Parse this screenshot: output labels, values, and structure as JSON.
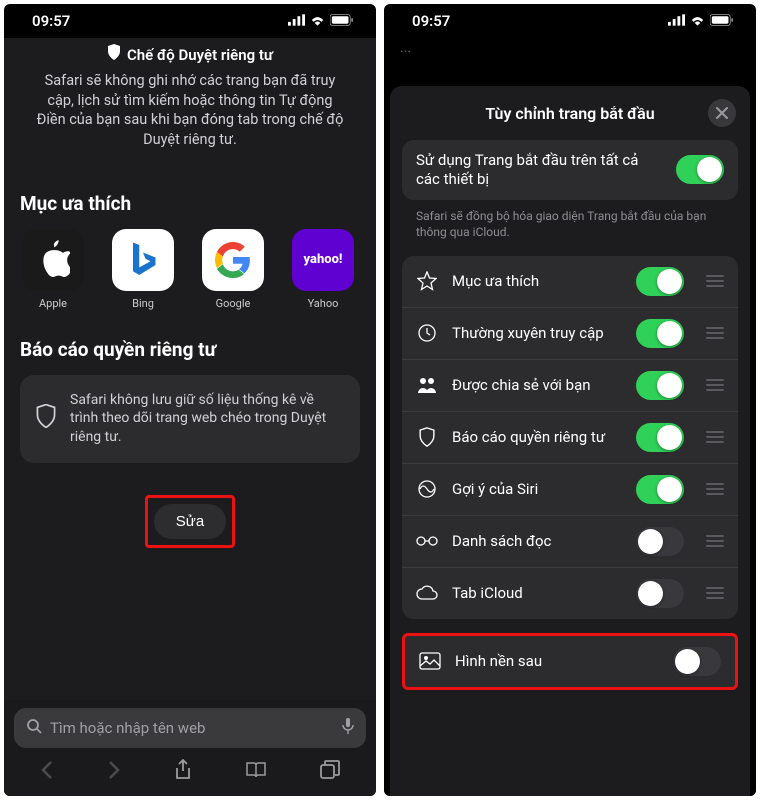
{
  "status": {
    "time": "09:57"
  },
  "left": {
    "private_title": "Chế độ Duyệt riêng tư",
    "private_desc": "Safari sẽ không ghi nhớ các trang bạn đã truy cập, lịch sử tìm kiếm hoặc thông tin Tự động Điền của bạn sau khi bạn đóng tab trong chế độ Duyệt riêng tư.",
    "favorites_title": "Mục ưa thích",
    "favorites": [
      {
        "label": "Apple"
      },
      {
        "label": "Bing"
      },
      {
        "label": "Google"
      },
      {
        "label": "Yahoo"
      }
    ],
    "privacy_section_title": "Báo cáo quyền riêng tư",
    "privacy_card": "Safari không lưu giữ số liệu thống kê về trình theo dõi trang web chéo trong Duyệt riêng tư.",
    "edit_label": "Sửa",
    "search_placeholder": "Tìm hoặc nhập tên web"
  },
  "right": {
    "sheet_title": "Tùy chỉnh trang bắt đầu",
    "sync_label": "Sử dụng Trang bắt đầu trên tất cả các thiết bị",
    "sync_hint": "Safari sẽ đồng bộ hóa giao diện Trang bắt đầu của bạn thông qua iCloud.",
    "items": [
      {
        "label": "Mục ưa thích",
        "on": true
      },
      {
        "label": "Thường xuyên truy cập",
        "on": true
      },
      {
        "label": "Được chia sẻ với bạn",
        "on": true
      },
      {
        "label": "Báo cáo quyền riêng tư",
        "on": true
      },
      {
        "label": "Gợi ý của Siri",
        "on": true
      },
      {
        "label": "Danh sách đọc",
        "on": false
      },
      {
        "label": "Tab iCloud",
        "on": false
      }
    ],
    "background_label": "Hình nền sau"
  },
  "icons": {
    "yahoo_text": "yahoo!"
  }
}
